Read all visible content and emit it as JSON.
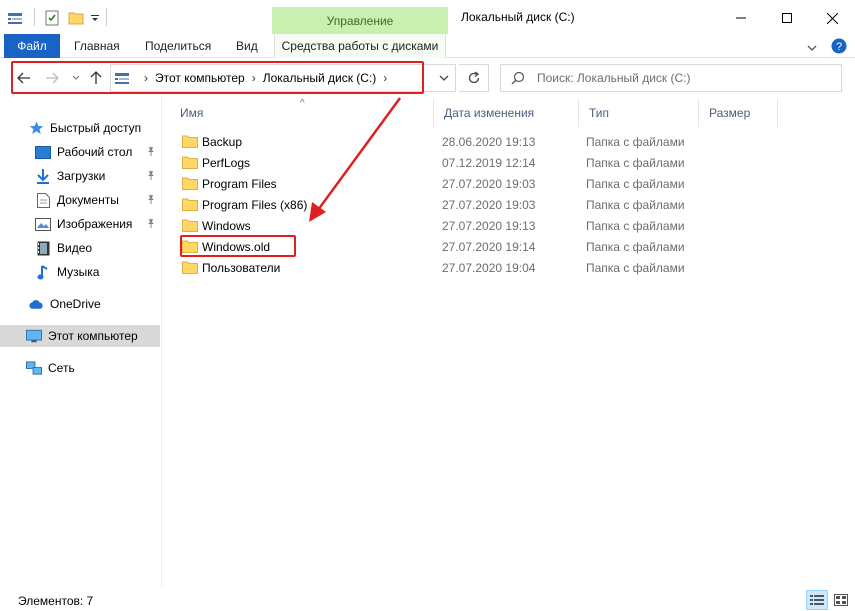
{
  "window": {
    "title": "Локальный диск (C:)",
    "context_tab": "Управление"
  },
  "ribbon": {
    "file_tab": "Файл",
    "tabs": [
      "Главная",
      "Поделиться",
      "Вид"
    ],
    "context_tab_label": "Средства работы с дисками"
  },
  "address": {
    "crumbs": [
      "Этот компьютер",
      "Локальный диск (C:)"
    ]
  },
  "search": {
    "placeholder": "Поиск: Локальный диск (C:)"
  },
  "nav": {
    "quick_access": "Быстрый доступ",
    "desktop": "Рабочий стол",
    "downloads": "Загрузки",
    "documents": "Документы",
    "pictures": "Изображения",
    "video": "Видео",
    "music": "Музыка",
    "onedrive": "OneDrive",
    "this_pc": "Этот компьютер",
    "network": "Сеть"
  },
  "columns": {
    "name": "Имя",
    "date": "Дата изменения",
    "type": "Тип",
    "size": "Размер"
  },
  "files": [
    {
      "name": "Backup",
      "date": "28.06.2020 19:13",
      "type": "Папка с файлами"
    },
    {
      "name": "PerfLogs",
      "date": "07.12.2019 12:14",
      "type": "Папка с файлами"
    },
    {
      "name": "Program Files",
      "date": "27.07.2020 19:03",
      "type": "Папка с файлами"
    },
    {
      "name": "Program Files (x86)",
      "date": "27.07.2020 19:03",
      "type": "Папка с файлами"
    },
    {
      "name": "Windows",
      "date": "27.07.2020 19:13",
      "type": "Папка с файлами"
    },
    {
      "name": "Windows.old",
      "date": "27.07.2020 19:14",
      "type": "Папка с файлами"
    },
    {
      "name": "Пользователи",
      "date": "27.07.2020 19:04",
      "type": "Папка с файлами"
    }
  ],
  "status": {
    "items_count": "Элементов: 7"
  },
  "colors": {
    "accent": "#1a63c6",
    "context_green": "#c9f0b0",
    "highlight_red": "#e02020",
    "folder_yellow": "#ffd766"
  }
}
